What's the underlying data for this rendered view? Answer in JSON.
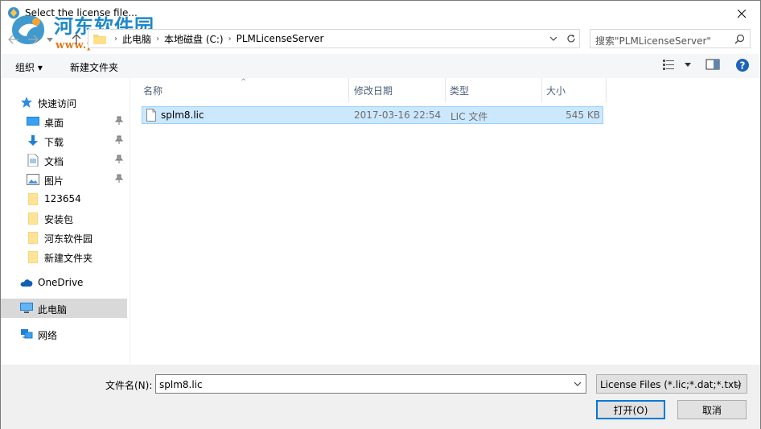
{
  "window": {
    "title": "Select the license file..."
  },
  "watermark": {
    "site_name": "河东软件园",
    "url": "www.pc0359.cn"
  },
  "address": {
    "crumbs": [
      "此电脑",
      "本地磁盘 (C:)",
      "PLMLicenseServer"
    ]
  },
  "search": {
    "placeholder": "搜索\"PLMLicenseServer\""
  },
  "toolbar": {
    "organize_label": "组织 ▾",
    "new_folder_label": "新建文件夹"
  },
  "sidebar": {
    "items": [
      {
        "label": "快速访问",
        "icon": "star-icon"
      },
      {
        "label": "桌面",
        "icon": "desktop-icon",
        "pinned": true
      },
      {
        "label": "下载",
        "icon": "download-icon",
        "pinned": true
      },
      {
        "label": "文档",
        "icon": "document-icon",
        "pinned": true
      },
      {
        "label": "图片",
        "icon": "picture-icon",
        "pinned": true
      },
      {
        "label": "123654",
        "icon": "folder-icon"
      },
      {
        "label": "安装包",
        "icon": "folder-icon"
      },
      {
        "label": "河东软件园",
        "icon": "folder-icon"
      },
      {
        "label": "新建文件夹",
        "icon": "folder-icon"
      },
      {
        "label": "OneDrive",
        "icon": "cloud-icon"
      },
      {
        "label": "此电脑",
        "icon": "computer-icon",
        "selected": true
      },
      {
        "label": "网络",
        "icon": "network-icon"
      }
    ]
  },
  "filelist": {
    "columns": [
      "名称",
      "修改日期",
      "类型",
      "大小"
    ],
    "rows": [
      {
        "name": "splm8.lic",
        "modified": "2017-03-16 22:54",
        "type": "LIC 文件",
        "size": "545 KB",
        "selected": true
      }
    ]
  },
  "footer": {
    "filename_label": "文件名(N):",
    "filename_value": "splm8.lic",
    "filetype_value": "License Files (*.lic;*.dat;*.txt)",
    "open_label": "打开(O)",
    "cancel_label": "取消"
  },
  "colors": {
    "accent": "#0078d7",
    "selection_bg": "#cce8ff",
    "selection_border": "#99d1ff",
    "header_text": "#4c607a",
    "watermark_blue": "#1e88c8",
    "watermark_orange": "#e07b1a"
  }
}
